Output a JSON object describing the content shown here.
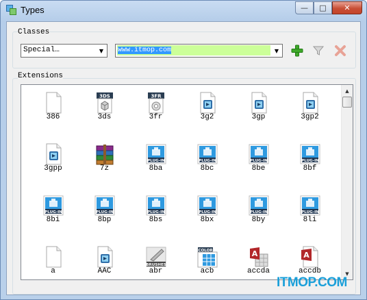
{
  "window": {
    "title": "Types"
  },
  "caption": {
    "minimize": "—",
    "maximize": "□",
    "close": "✕"
  },
  "classes": {
    "group_label": "Classes",
    "class_value": "Special…",
    "extension_value": "www.itmop.com",
    "add_icon": "plus-icon",
    "filter_icon": "filter-icon",
    "delete_icon": "delete-icon"
  },
  "extensions": {
    "group_label": "Extensions",
    "items": [
      {
        "label": "386",
        "icon": "blank-file-icon"
      },
      {
        "label": "3ds",
        "icon": "3ds-icon",
        "tag": "3DS"
      },
      {
        "label": "3fr",
        "icon": "3fr-icon",
        "tag": "3FR"
      },
      {
        "label": "3g2",
        "icon": "video-file-icon"
      },
      {
        "label": "3gp",
        "icon": "video-file-icon"
      },
      {
        "label": "3gp2",
        "icon": "video-file-icon"
      },
      {
        "label": "3gpp",
        "icon": "video-file-icon"
      },
      {
        "label": "7z",
        "icon": "archive-icon"
      },
      {
        "label": "8ba",
        "icon": "plugin-icon",
        "tag": "PLUG-IN"
      },
      {
        "label": "8bc",
        "icon": "plugin-icon",
        "tag": "PLUG-IN"
      },
      {
        "label": "8be",
        "icon": "plugin-icon",
        "tag": "PLUG-IN"
      },
      {
        "label": "8bf",
        "icon": "plugin-icon",
        "tag": "PLUG-IN"
      },
      {
        "label": "8bi",
        "icon": "plugin-icon",
        "tag": "PLUG-IN"
      },
      {
        "label": "8bp",
        "icon": "plugin-icon",
        "tag": "PLUG-IN"
      },
      {
        "label": "8bs",
        "icon": "plugin-icon",
        "tag": "PLUG-IN"
      },
      {
        "label": "8bx",
        "icon": "plugin-icon",
        "tag": "PLUG-IN"
      },
      {
        "label": "8by",
        "icon": "plugin-icon",
        "tag": "PLUG-IN"
      },
      {
        "label": "8li",
        "icon": "plugin-icon",
        "tag": "PLUG-IN"
      },
      {
        "label": "a",
        "icon": "blank-file-icon"
      },
      {
        "label": "AAC",
        "icon": "video-file-icon"
      },
      {
        "label": "abr",
        "icon": "brushes-icon",
        "tag": "BRUSHES"
      },
      {
        "label": "acb",
        "icon": "color-book-icon",
        "tag": "COLOR"
      },
      {
        "label": "accda",
        "icon": "access-addin-icon"
      },
      {
        "label": "accdb",
        "icon": "access-db-icon"
      }
    ]
  },
  "watermark": "ITMOP.COM",
  "colors": {
    "plugin_blue": "#2f9ae0",
    "ext_field_bg": "#ccff99",
    "add_green": "#3ea82a",
    "delete_red": "#e07a6a"
  }
}
